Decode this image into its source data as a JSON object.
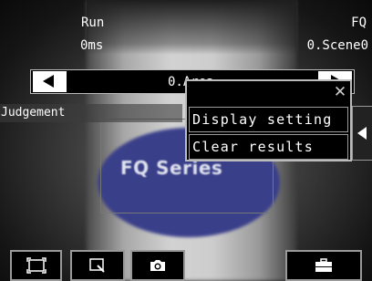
{
  "status": {
    "run": "Run",
    "time": "0ms",
    "device": "FQ",
    "scene": "0.Scene0"
  },
  "area_bar": {
    "title": "0.Area"
  },
  "judgement_label": "Judgement",
  "camera": {
    "product_label": "FQ Series"
  },
  "popup_menu": {
    "close_symbol": "✕",
    "items": [
      {
        "label": "Display setting"
      },
      {
        "label": "Clear results"
      }
    ]
  },
  "toolbar": {
    "buttons": [
      {
        "icon": "fullscreen-icon"
      },
      {
        "icon": "zoom-icon"
      },
      {
        "icon": "camera-icon"
      },
      {
        "icon": "toolbox-icon"
      }
    ]
  },
  "colors": {
    "label_oval": "#3a3f8a",
    "border": "#bbbbbb"
  }
}
